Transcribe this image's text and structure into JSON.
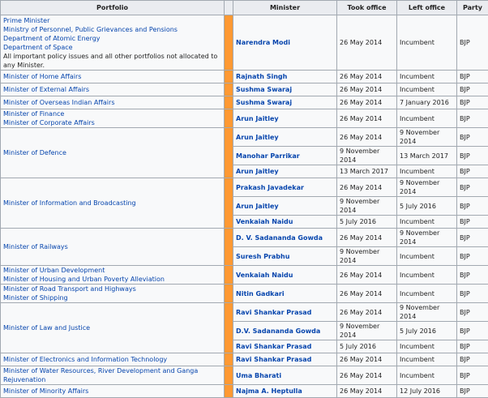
{
  "headers": [
    "Portfolio",
    "Minister",
    "Took office",
    "Left office",
    "Party"
  ],
  "rows": [
    {
      "portfolio": [
        "Prime Minister",
        "Ministry of Personnel, Public Grievances and Pensions",
        "Department of Atomic Energy",
        "Department of Space"
      ],
      "portfolio_note": "All important policy issues and all other portfolios not allocated to any Minister.",
      "terms": [
        {
          "minister": "Narendra Modi",
          "took": "26 May 2014",
          "left": "Incumbent",
          "party": "BJP"
        }
      ]
    },
    {
      "portfolio": [
        "Minister of Home Affairs"
      ],
      "terms": [
        {
          "minister": "Rajnath Singh",
          "took": "26 May 2014",
          "left": "Incumbent",
          "party": "BJP"
        }
      ]
    },
    {
      "portfolio": [
        "Minister of External Affairs"
      ],
      "terms": [
        {
          "minister": "Sushma Swaraj",
          "took": "26 May 2014",
          "left": "Incumbent",
          "party": "BJP"
        }
      ]
    },
    {
      "portfolio": [
        "Minister of Overseas Indian Affairs"
      ],
      "terms": [
        {
          "minister": "Sushma Swaraj",
          "took": "26 May 2014",
          "left": "7 January 2016",
          "party": "BJP"
        }
      ]
    },
    {
      "portfolio": [
        "Minister of Finance",
        "Minister of Corporate Affairs"
      ],
      "terms": [
        {
          "minister": "Arun Jaitley",
          "took": "26 May 2014",
          "left": "Incumbent",
          "party": "BJP"
        }
      ]
    },
    {
      "portfolio": [
        "Minister of Defence"
      ],
      "terms": [
        {
          "minister": "Arun Jaitley",
          "took": "26 May 2014",
          "left": "9 November 2014",
          "party": "BJP"
        },
        {
          "minister": "Manohar Parrikar",
          "took": "9 November 2014",
          "left": "13 March 2017",
          "party": "BJP"
        },
        {
          "minister": "Arun Jaitley",
          "took": "13 March 2017",
          "left": "Incumbent",
          "party": "BJP"
        }
      ]
    },
    {
      "portfolio": [
        "Minister of Information and Broadcasting"
      ],
      "terms": [
        {
          "minister": "Prakash Javadekar",
          "took": "26 May 2014",
          "left": "9 November 2014",
          "party": "BJP"
        },
        {
          "minister": "Arun Jaitley",
          "took": "9 November 2014",
          "left": "5 July 2016",
          "party": "BJP"
        },
        {
          "minister": "Venkaiah Naidu",
          "took": "5 July 2016",
          "left": "Incumbent",
          "party": "BJP"
        }
      ]
    },
    {
      "portfolio": [
        "Minister of Railways"
      ],
      "terms": [
        {
          "minister": "D. V. Sadananda Gowda",
          "took": "26 May 2014",
          "left": "9 November 2014",
          "party": "BJP"
        },
        {
          "minister": "Suresh Prabhu",
          "took": "9 November 2014",
          "left": "Incumbent",
          "party": "BJP"
        }
      ]
    },
    {
      "portfolio": [
        "Minister of Urban Development",
        "Minister of Housing and Urban Poverty Alleviation"
      ],
      "terms": [
        {
          "minister": "Venkaiah Naidu",
          "took": "26 May 2014",
          "left": "Incumbent",
          "party": "BJP"
        }
      ]
    },
    {
      "portfolio": [
        "Minister of Road Transport and Highways",
        "Minister of Shipping"
      ],
      "terms": [
        {
          "minister": "Nitin Gadkari",
          "took": "26 May 2014",
          "left": "Incumbent",
          "party": "BJP"
        }
      ]
    },
    {
      "portfolio": [
        "Minister of Law and Justice"
      ],
      "terms": [
        {
          "minister": "Ravi Shankar Prasad",
          "took": "26 May 2014",
          "left": "9 November 2014",
          "party": "BJP"
        },
        {
          "minister": "D.V. Sadananda Gowda",
          "took": "9 November 2014",
          "left": "5 July 2016",
          "party": "BJP"
        },
        {
          "minister": "Ravi Shankar Prasad",
          "took": "5 July 2016",
          "left": "Incumbent",
          "party": "BJP"
        }
      ]
    },
    {
      "portfolio": [
        "Minister of Electronics and Information Technology"
      ],
      "terms": [
        {
          "minister": "Ravi Shankar Prasad",
          "took": "26 May 2014",
          "left": "Incumbent",
          "party": "BJP"
        }
      ]
    },
    {
      "portfolio": [
        "Minister of Water Resources, River Development and Ganga Rejuvenation"
      ],
      "terms": [
        {
          "minister": "Uma Bharati",
          "took": "26 May 2014",
          "left": "Incumbent",
          "party": "BJP"
        }
      ]
    },
    {
      "portfolio": [
        "Minister of Minority Affairs"
      ],
      "terms": [
        {
          "minister": "Najma A. Heptulla",
          "took": "26 May 2014",
          "left": "12 July 2016",
          "party": "BJP"
        }
      ]
    }
  ],
  "colors": {
    "party_bar": "#ff9933",
    "header_bg": "#eaecf0",
    "cell_bg": "#f8f9fa",
    "link": "#0645ad",
    "border": "#a2a9b1"
  }
}
